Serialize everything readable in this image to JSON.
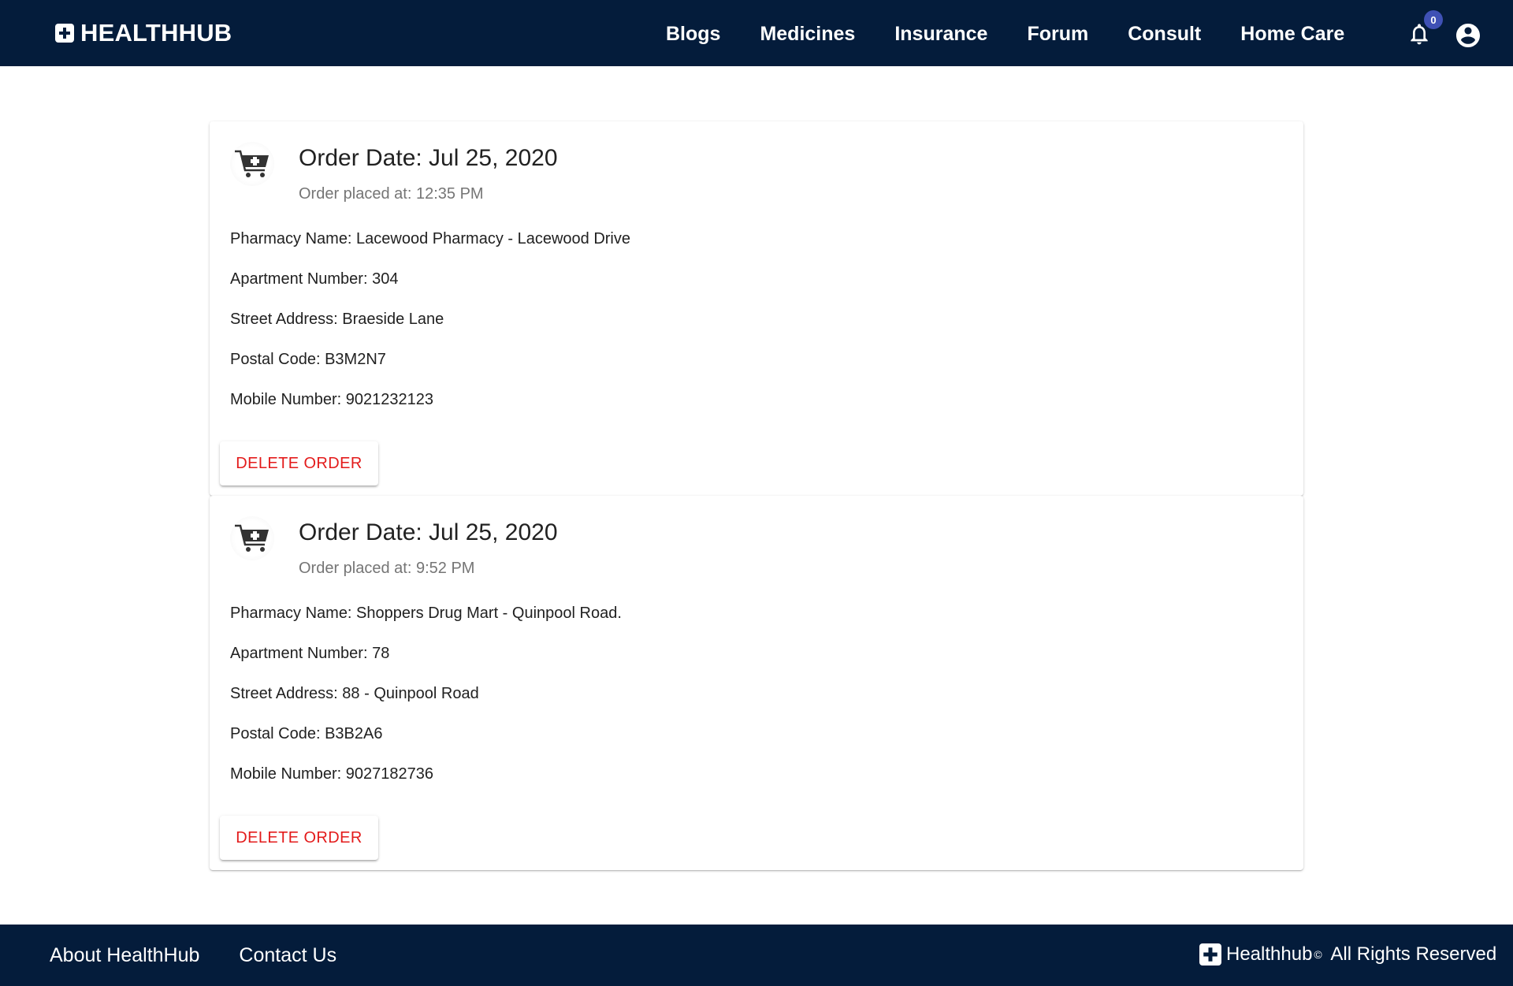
{
  "header": {
    "brand": "HEALTHHUB",
    "nav": [
      "Blogs",
      "Medicines",
      "Insurance",
      "Forum",
      "Consult",
      "Home Care"
    ],
    "notification_count": "0"
  },
  "orders": [
    {
      "title": "Order Date: Jul 25, 2020",
      "subtitle": "Order placed at: 12:35 PM",
      "pharmacy": "Pharmacy Name: Lacewood Pharmacy - Lacewood Drive",
      "apartment": "Apartment Number: 304",
      "street": "Street Address: Braeside Lane",
      "postal": "Postal Code: B3M2N7",
      "mobile": "Mobile Number: 9021232123",
      "delete_label": "DELETE ORDER"
    },
    {
      "title": "Order Date: Jul 25, 2020",
      "subtitle": "Order placed at: 9:52 PM",
      "pharmacy": "Pharmacy Name: Shoppers Drug Mart - Quinpool Road.",
      "apartment": "Apartment Number: 78",
      "street": "Street Address: 88 - Quinpool Road",
      "postal": "Postal Code: B3B2A6",
      "mobile": "Mobile Number: 9027182736",
      "delete_label": "DELETE ORDER"
    }
  ],
  "footer": {
    "about": "About HealthHub",
    "contact": "Contact Us",
    "copyright_brand": "Healthhub",
    "copyright_mark": "©",
    "copyright_text": "All Rights Reserved"
  },
  "icons": {
    "logo": "medical-plus-icon",
    "notification": "bell-icon",
    "account": "account-circle-icon",
    "order": "medical-cart-icon"
  },
  "colors": {
    "header_bg": "#041c3b",
    "badge": "#3f51b5",
    "delete_text": "#e31b1b"
  }
}
